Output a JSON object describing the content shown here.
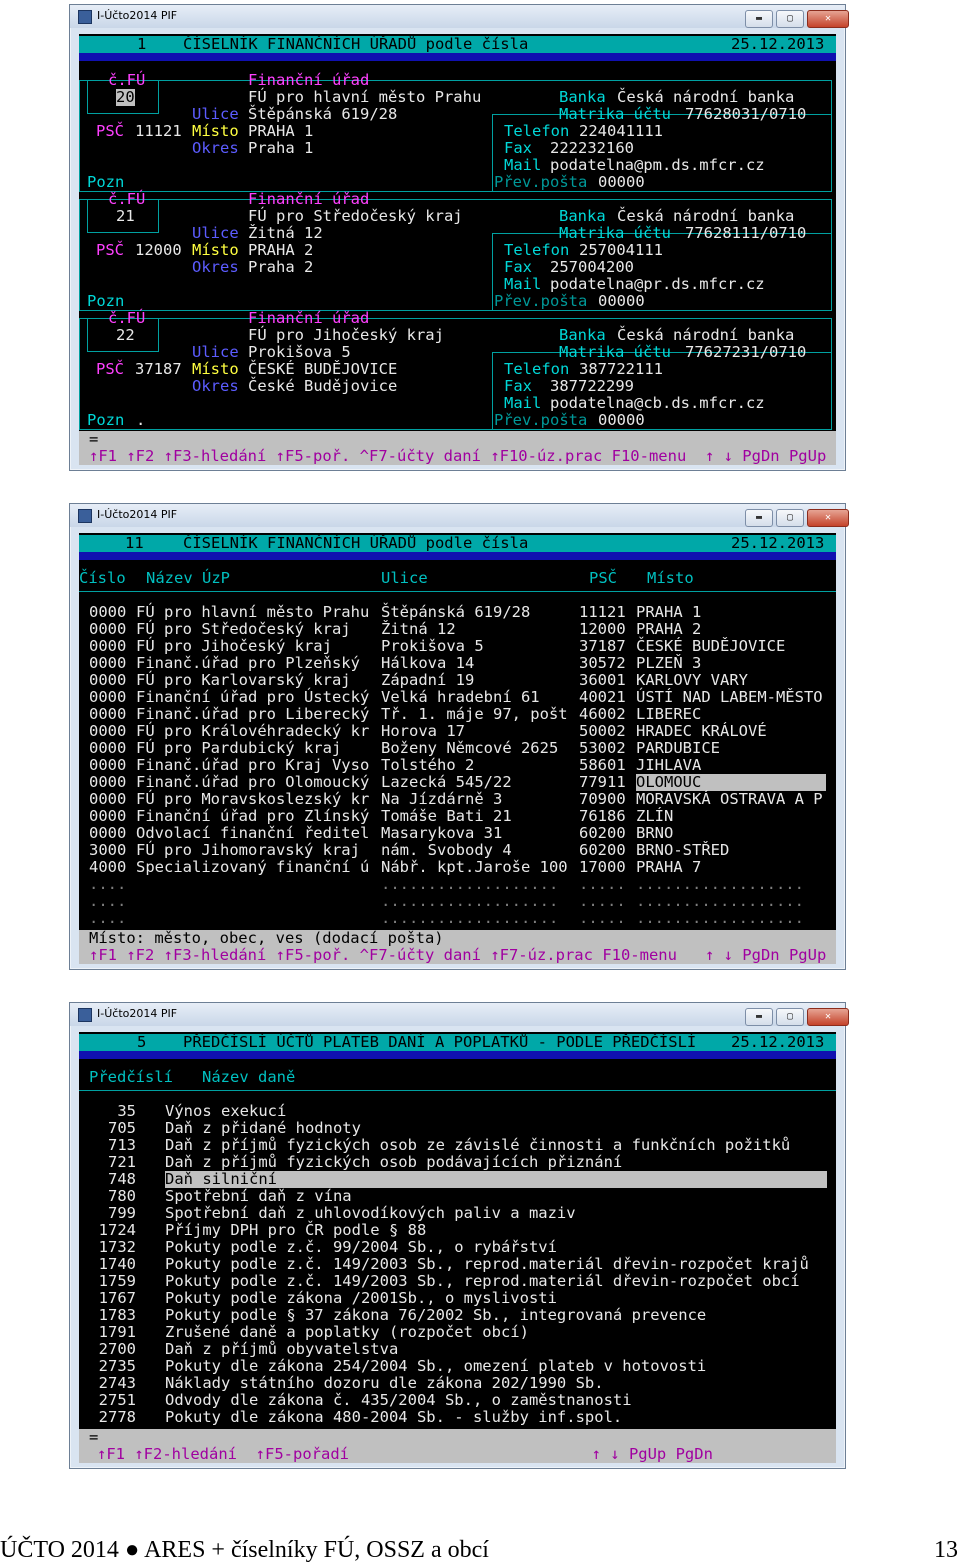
{
  "window": {
    "app_title": "I-Účto2014 PIF",
    "min": "▬",
    "max": "▢",
    "close": "✕"
  },
  "screen1": {
    "topbar": {
      "num": "1",
      "title": "ČÍSELNÍK FINANČNÍCH ÚŘADŮ podle čísla",
      "date": "25.12.2013"
    },
    "labels": {
      "cfu": "č.FÚ",
      "fu": "Finanční úřad",
      "ulice": "Ulice",
      "psc": "PSČ",
      "misto": "Místo",
      "okres": "Okres",
      "banka": "Banka",
      "matrika": "Matrika účtu",
      "telefon": "Telefon",
      "fax": "Fax",
      "mail": "Mail",
      "prev": "Přev.pošta",
      "pozn": "Pozn"
    },
    "records": [
      {
        "cislo": "20",
        "nazev": "FÚ pro hlavní město Prahu",
        "ulice": "Štěpánská 619/28",
        "psc": "11121",
        "misto": "PRAHA 1",
        "okres": "Praha 1",
        "banka": "Česká národní banka",
        "matrika": "77628031/0710",
        "telefon": "224041111",
        "fax": "222232160",
        "mail": "podatelna@pm.ds.mfcr.cz",
        "prev": "00000",
        "pozn": ""
      },
      {
        "cislo": "21",
        "nazev": "FÚ pro Středočeský kraj",
        "ulice": "Žitná 12",
        "psc": "12000",
        "misto": "PRAHA 2",
        "okres": "Praha 2",
        "banka": "Česká národní banka",
        "matrika": "77628111/0710",
        "telefon": "257004111",
        "fax": "257004200",
        "mail": "podatelna@pr.ds.mfcr.cz",
        "prev": "00000",
        "pozn": ""
      },
      {
        "cislo": "22",
        "nazev": "FÚ pro Jihočeský kraj",
        "ulice": "Prokišova 5",
        "psc": "37187",
        "misto": "ČESKÉ BUDĚJOVICE",
        "okres": "České Budějovice",
        "banka": "Česká národní banka",
        "matrika": "77627231/0710",
        "telefon": "387722111",
        "fax": "387722299",
        "mail": "podatelna@cb.ds.mfcr.cz",
        "prev": "00000",
        "pozn": "."
      }
    ],
    "status": "=",
    "fkeys": [
      [
        "↑F1",
        " ↑F2 ",
        "↑F3-hledání",
        " ↑F5-poř. ",
        "^F7-účty daní",
        " ↑F10-úz.prac ",
        "F10-menu",
        "  ↑ ↓ PgDn PgUp"
      ]
    ]
  },
  "screen2": {
    "topbar": {
      "num": "11",
      "title": "ČÍSELNÍK FINANČNÍCH ÚŘADŮ podle čísla",
      "date": "25.12.2013"
    },
    "headers": {
      "cislo": "Číslo",
      "nazev": "Název ÚzP",
      "ulice": "Ulice",
      "psc": "PSČ",
      "misto": "Místo"
    },
    "rows": [
      [
        "0000",
        "FÚ pro hlavní město Prahu",
        "Štěpánská 619/28",
        "11121",
        "PRAHA 1"
      ],
      [
        "0000",
        "FÚ pro Středočeský kraj",
        "Žitná 12",
        "12000",
        "PRAHA 2"
      ],
      [
        "0000",
        "FÚ pro Jihočeský kraj",
        "Prokišova 5",
        "37187",
        "ČESKÉ BUDĚJOVICE"
      ],
      [
        "0000",
        "Finanč.úřad pro Plzeňský",
        "Hálkova 14",
        "30572",
        "PLZEŇ 3"
      ],
      [
        "0000",
        "FÚ pro Karlovarský kraj",
        "Západní 19",
        "36001",
        "KARLOVY VARY"
      ],
      [
        "0000",
        "Finanční úřad pro Ústecký",
        "Velká hradební 61",
        "40021",
        "ÚSTÍ NAD LABEM-MĚSTO"
      ],
      [
        "0000",
        "Finanč.úřad pro Liberecký",
        "Tř. 1. máje 97, pošt",
        "46002",
        "LIBEREC"
      ],
      [
        "0000",
        "FÚ pro Královéhradecký kr",
        "Horova 17",
        "50002",
        "HRADEC KRÁLOVÉ"
      ],
      [
        "0000",
        "FÚ pro Pardubický kraj",
        "Boženy Němcové 2625",
        "53002",
        "PARDUBICE"
      ],
      [
        "0000",
        "Finanč.úřad pro Kraj Vyso",
        "Tolstého 2",
        "58601",
        "JIHLAVA"
      ],
      [
        "0000",
        "Finanč.úřad pro Olomoucký",
        "Lazecká 545/22",
        "77911",
        "OLOMOUC"
      ],
      [
        "0000",
        "FÚ pro Moravskoslezský kr",
        "Na Jízdárně 3",
        "70900",
        "MORAVSKÁ OSTRAVA A P"
      ],
      [
        "0000",
        "Finanční úřad pro Zlínský",
        "Tomáše Bati 21",
        "76186",
        "ZLÍN"
      ],
      [
        "0000",
        "Odvolací finanční ředitel",
        "Masarykova 31",
        "60200",
        "BRNO"
      ],
      [
        "3000",
        "FÚ pro Jihomoravský kraj",
        "nám. Svobody 4",
        "60200",
        "BRNO-STŘED"
      ],
      [
        "4000",
        "Specializovaný finanční ú",
        "Nábř. kpt.Jaroše 100",
        "17000",
        "PRAHA 7"
      ],
      [
        "....",
        "",
        "...................",
        ".....",
        ".................."
      ],
      [
        "....",
        "",
        "...................",
        ".....",
        ".................."
      ],
      [
        "....",
        "",
        "...................",
        ".....",
        ".................."
      ]
    ],
    "selected_row": 10,
    "status": "Místo: město, obec, ves (dodací pošta)",
    "fkeys": [
      "↑F1",
      " ↑F2 ",
      "↑F3-hledání",
      " ↑F5-poř. ",
      "^F7-účty daní",
      " ↑F7-úz.prac ",
      "F10-menu",
      "   ↑ ↓ PgDn PgUp"
    ]
  },
  "screen3": {
    "topbar": {
      "num": "5",
      "title": "PŘEDČÍSLÍ ÚČTŮ PLATEB DANÍ A POPLATKŮ - PODLE PŘEDČÍSLÍ",
      "date": "25.12.2013"
    },
    "headers": {
      "predcisli": "Předčíslí",
      "nazev": "Název daně"
    },
    "rows": [
      [
        "35",
        "Výnos exekucí"
      ],
      [
        "705",
        "Daň z přidané hodnoty"
      ],
      [
        "713",
        "Daň z příjmů fyzických osob ze závislé činnosti a funkčních požitků"
      ],
      [
        "721",
        "Daň z příjmů fyzických osob podávajících přiznání"
      ],
      [
        "748",
        "Daň silniční"
      ],
      [
        "780",
        "Spotřební daň z vína"
      ],
      [
        "799",
        "Spotřební daň z uhlovodíkových paliv a maziv"
      ],
      [
        "1724",
        "Příjmy DPH pro ČR podle § 88"
      ],
      [
        "1732",
        "Pokuty podle z.č. 99/2004 Sb., o rybářství"
      ],
      [
        "1740",
        "Pokuty podle z.č. 149/2003 Sb., reprod.materiál dřevin-rozpočet krajů"
      ],
      [
        "1759",
        "Pokuty podle z.č. 149/2003 Sb., reprod.materiál dřevin-rozpočet obcí"
      ],
      [
        "1767",
        "Pokuty podle zákona /2001Sb., o myslivosti"
      ],
      [
        "1783",
        "Pokuty podle § 37 zákona 76/2002 Sb., integrovaná prevence"
      ],
      [
        "1791",
        "Zrušené daně a poplatky (rozpočet obcí)"
      ],
      [
        "2700",
        "Daň z příjmů obyvatelstva"
      ],
      [
        "2735",
        "Pokuty dle zákona 254/2004 Sb., omezení plateb v hotovosti"
      ],
      [
        "2743",
        "Náklady státního dozoru dle zákona 202/1990 Sb."
      ],
      [
        "2751",
        "Odvody dle zákona č. 435/2004 Sb., o zaměstnanosti"
      ],
      [
        "2778",
        "Pokuty dle zákona 480-2004 Sb. - služby inf.spol."
      ]
    ],
    "selected_row": 4,
    "status": "=",
    "fkeys": [
      "↑F1",
      " ↑F2-hledání ",
      " ↑F5-pořadí",
      "                          ↑ ↓ PgUp PgDn"
    ]
  },
  "footer": {
    "text": "ÚČTO 2014 ● ARES + číselníky FÚ, OSSZ a obcí",
    "page": "13"
  }
}
